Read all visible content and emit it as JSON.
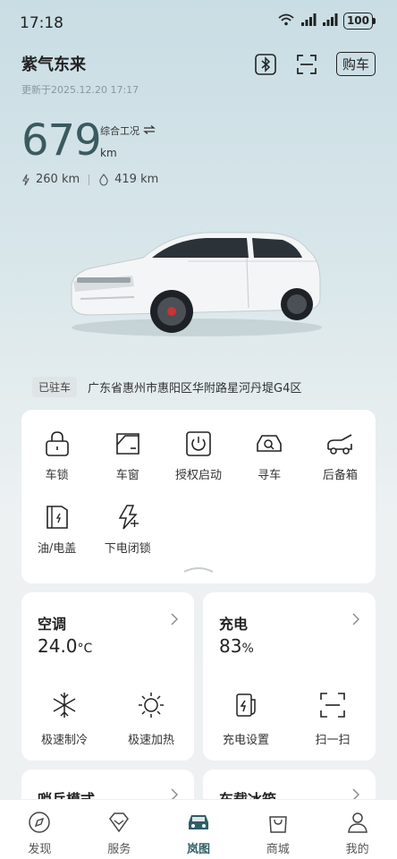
{
  "status_bar": {
    "time": "17:18",
    "battery": "100",
    "icons": [
      "wifi-icon",
      "signal-icon",
      "signal-icon",
      "battery-icon"
    ]
  },
  "header": {
    "car_name": "紫气东来",
    "update_time": "更新于2025.12.20 17:17",
    "buy_label": "购车",
    "icons": [
      "bluetooth-icon",
      "scan-icon"
    ]
  },
  "range": {
    "value": "679",
    "unit": "km",
    "mode": "综合工况",
    "electric": "260 km",
    "fuel": "419 km"
  },
  "location": {
    "badge": "已驻车",
    "address": "广东省惠州市惠阳区华附路星河丹堤G4区"
  },
  "controls": [
    {
      "label": "车锁",
      "icon": "lock-icon"
    },
    {
      "label": "车窗",
      "icon": "window-icon"
    },
    {
      "label": "授权启动",
      "icon": "power-icon"
    },
    {
      "label": "寻车",
      "icon": "find-car-icon"
    },
    {
      "label": "后备箱",
      "icon": "trunk-icon"
    },
    {
      "label": "油/电盖",
      "icon": "fuel-cap-icon"
    },
    {
      "label": "下电闭锁",
      "icon": "power-off-lock-icon"
    }
  ],
  "climate": {
    "title": "空调",
    "temp": "24.0",
    "temp_unit": "°C",
    "action1": "极速制冷",
    "action2": "极速加热"
  },
  "charging": {
    "title": "充电",
    "percent": "83",
    "percent_unit": "%",
    "action1": "充电设置",
    "action2": "扫一扫"
  },
  "bottom_cards": {
    "left_title": "哨兵模式",
    "right_title": "车载冰箱"
  },
  "tabs": [
    {
      "label": "发现",
      "icon": "compass-icon"
    },
    {
      "label": "服务",
      "icon": "diamond-icon"
    },
    {
      "label": "岚图",
      "icon": "car-icon",
      "active": true
    },
    {
      "label": "商城",
      "icon": "shopping-bag-icon"
    },
    {
      "label": "我的",
      "icon": "person-icon"
    }
  ],
  "colors": {
    "accent": "#2f5e67",
    "range_number": "#3a5a60"
  }
}
